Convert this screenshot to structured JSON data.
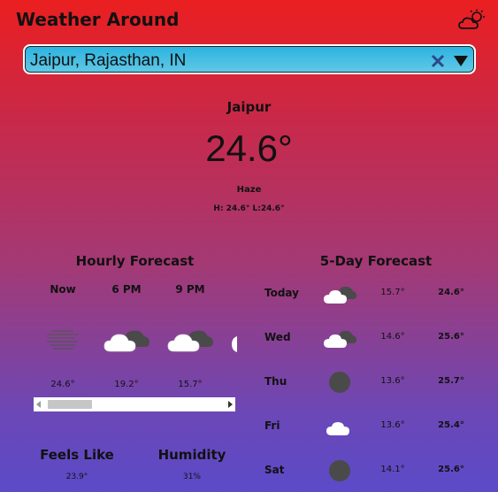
{
  "app": {
    "title": "Weather Around"
  },
  "search": {
    "value": "Jaipur, Rajasthan, IN"
  },
  "current": {
    "city": "Jaipur",
    "temp": "24.6°",
    "condition": "Haze",
    "hilo": "H: 24.6° L:24.6°"
  },
  "hourly": {
    "title": "Hourly Forecast",
    "items": [
      {
        "label": "Now",
        "icon": "haze-icon",
        "temp": "24.6°"
      },
      {
        "label": "6 PM",
        "icon": "cloudy-icon",
        "temp": "19.2°"
      },
      {
        "label": "9 PM",
        "icon": "cloudy-icon",
        "temp": "15.7°"
      }
    ],
    "scroll_position": 0.0
  },
  "daily": {
    "title": "5-Day Forecast",
    "items": [
      {
        "day": "Today",
        "icon": "cloudy-icon",
        "low": "15.7°",
        "high": "24.6°"
      },
      {
        "day": "Wed",
        "icon": "cloudy-icon",
        "low": "14.6°",
        "high": "25.6°"
      },
      {
        "day": "Thu",
        "icon": "overcast-icon",
        "low": "13.6°",
        "high": "25.7°"
      },
      {
        "day": "Fri",
        "icon": "cloud-icon",
        "low": "13.6°",
        "high": "25.4°"
      },
      {
        "day": "Sat",
        "icon": "overcast-icon",
        "low": "14.1°",
        "high": "25.6°"
      }
    ]
  },
  "stats": {
    "feels_like_label": "Feels Like",
    "feels_like": "23.9°",
    "humidity_label": "Humidity",
    "humidity": "31%"
  },
  "colors": {
    "gradient_top": "#ea1f20",
    "gradient_bottom": "#5b4ac8",
    "search_bg": "#2ab3df"
  }
}
